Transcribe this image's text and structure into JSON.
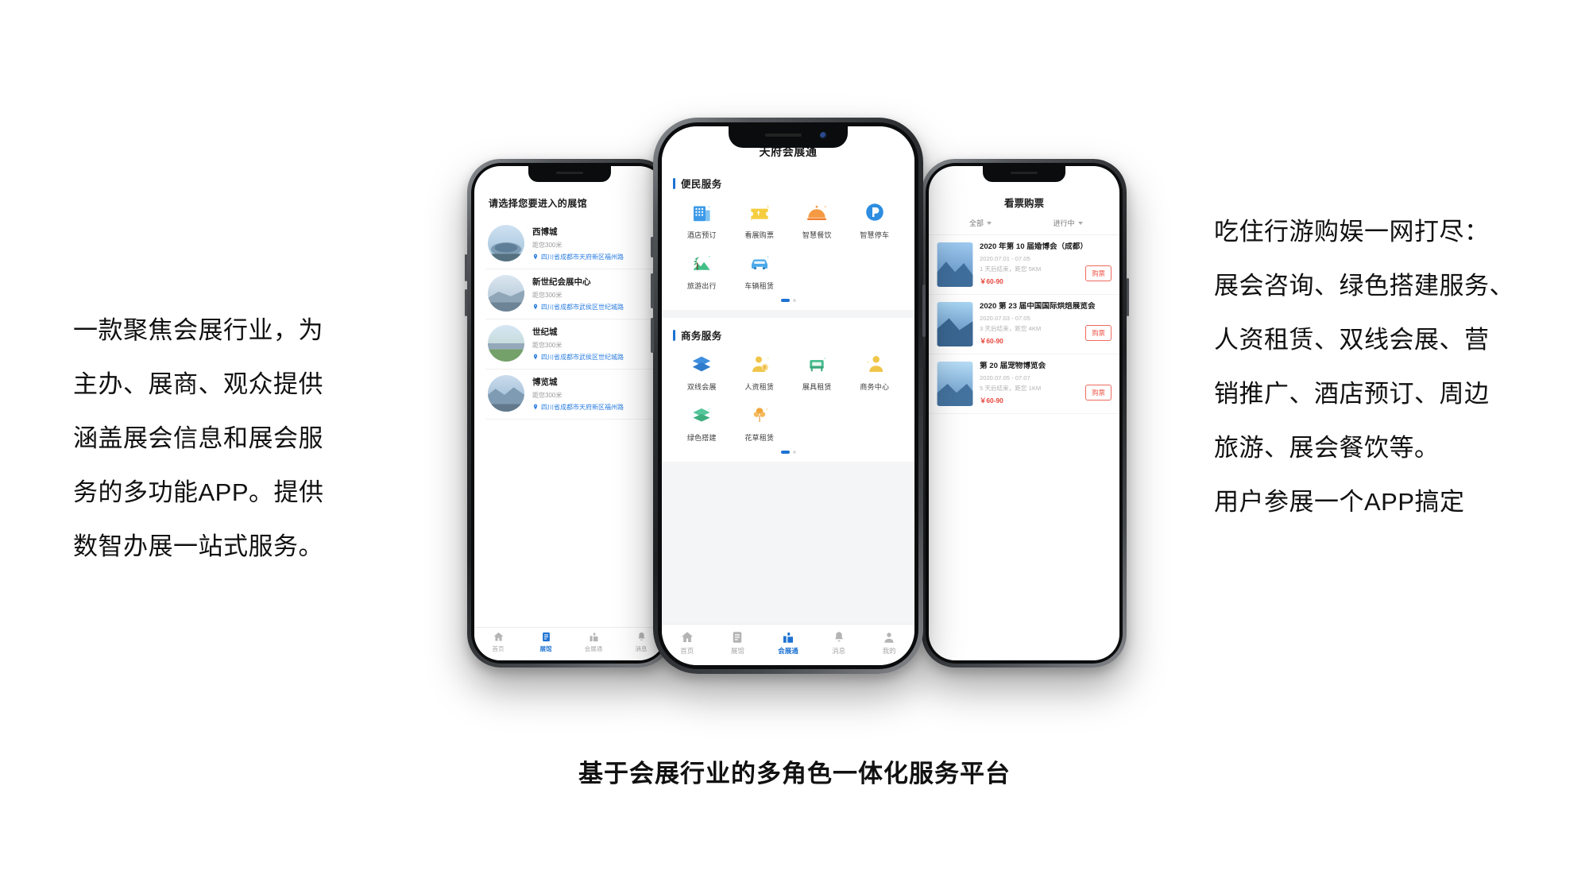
{
  "copy": {
    "left": "一款聚焦会展行业，为\n主办、展商、观众提供\n涵盖展会信息和展会服\n务的多功能APP。提供\n数智办展一站式服务。",
    "right": "吃住行游购娱一网打尽：\n展会咨询、绿色搭建服务、\n人资租赁、双线会展、营\n销推广、酒店预订、周边\n旅游、展会餐饮等。\n用户参展一个APP搞定"
  },
  "caption": "基于会展行业的多角色一体化服务平台",
  "colors": {
    "accent": "#1d72d2",
    "price": "#e8453c",
    "buy_border": "#ef6a5f",
    "muted": "#b3b3b3",
    "link": "#2a7de1"
  },
  "left_phone": {
    "title": "请选择您要进入的展馆",
    "venues": [
      {
        "name": "西博城",
        "distance": "距您300米",
        "address": "四川省成都市天府新区福州路",
        "pin_icon": "location-pin-icon"
      },
      {
        "name": "新世纪会展中心",
        "distance": "距您300米",
        "address": "四川省成都市武侯区世纪城路",
        "pin_icon": "location-pin-icon"
      },
      {
        "name": "世纪城",
        "distance": "距您300米",
        "address": "四川省成都市武侯区世纪城路",
        "pin_icon": "location-pin-icon"
      },
      {
        "name": "博览城",
        "distance": "距您300米",
        "address": "四川省成都市天府新区福州路",
        "pin_icon": "location-pin-icon"
      }
    ],
    "tabs": [
      {
        "label": "首页",
        "icon": "home-icon",
        "active": false
      },
      {
        "label": "展馆",
        "icon": "venue-icon",
        "active": true
      },
      {
        "label": "会展通",
        "icon": "expo-icon",
        "active": false
      },
      {
        "label": "消息",
        "icon": "bell-icon",
        "active": false
      }
    ]
  },
  "center_phone": {
    "app_title": "天府会展通",
    "sections": [
      {
        "title": "便民服务",
        "items": [
          {
            "label": "酒店预订",
            "icon": "hotel-icon"
          },
          {
            "label": "看展购票",
            "icon": "ticket-icon"
          },
          {
            "label": "智慧餐饮",
            "icon": "dining-icon"
          },
          {
            "label": "智慧停车",
            "icon": "parking-icon"
          },
          {
            "label": "旅游出行",
            "icon": "travel-icon"
          },
          {
            "label": "车辆租赁",
            "icon": "car-rental-icon"
          }
        ]
      },
      {
        "title": "商务服务",
        "items": [
          {
            "label": "双线会展",
            "icon": "layers-icon"
          },
          {
            "label": "人资租赁",
            "icon": "staffing-icon"
          },
          {
            "label": "展具租赁",
            "icon": "furniture-icon"
          },
          {
            "label": "商务中心",
            "icon": "business-center-icon"
          },
          {
            "label": "绿色搭建",
            "icon": "green-build-icon"
          },
          {
            "label": "花草租赁",
            "icon": "plant-rental-icon"
          }
        ]
      }
    ],
    "tabs": [
      {
        "label": "首页",
        "icon": "home-icon",
        "active": false
      },
      {
        "label": "展馆",
        "icon": "venue-icon",
        "active": false
      },
      {
        "label": "会展通",
        "icon": "expo-icon",
        "active": true
      },
      {
        "label": "消息",
        "icon": "bell-icon",
        "active": false
      },
      {
        "label": "我的",
        "icon": "user-icon",
        "active": false
      }
    ]
  },
  "right_phone": {
    "title": "看票购票",
    "filters": [
      {
        "label": "全部",
        "icon": "chevron-down-icon"
      },
      {
        "label": "进行中",
        "icon": "chevron-down-icon"
      }
    ],
    "events": [
      {
        "name": "2020 年第 10 届婚博会（成都）",
        "date": "2020.07.01 - 07.05",
        "meta": "1 天后结束，距您 5KM",
        "price": "￥60-90",
        "buy_label": "购票"
      },
      {
        "name": "2020 第 23 届中国国际烘焙展览会",
        "date": "2020.07.03 - 07.05",
        "meta": "3 天后结束，距您 4KM",
        "price": "￥60-90",
        "buy_label": "购票"
      },
      {
        "name": "第 20 届宠物博览会",
        "date": "2020.07.05 - 07.07",
        "meta": "5 天后结束，距您 1KM",
        "price": "￥60-90",
        "buy_label": "购票"
      }
    ]
  }
}
